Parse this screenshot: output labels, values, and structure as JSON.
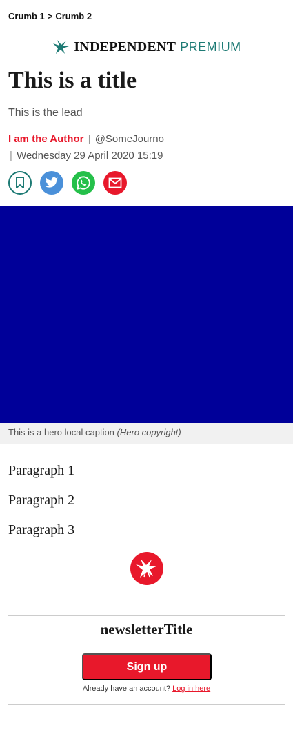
{
  "breadcrumbs": {
    "items": [
      "Crumb 1",
      "Crumb 2"
    ],
    "separator": ">"
  },
  "masthead": {
    "brand": "INDEPENDENT",
    "tier": "PREMIUM",
    "logo_icon": "eagle-icon"
  },
  "article": {
    "title": "This is a title",
    "lead": "This is the lead",
    "author": "I am the Author",
    "handle": "@SomeJourno",
    "date": "Wednesday 29 April 2020 15:19",
    "hero_color": "#000099",
    "caption": "This is a hero local caption",
    "copyright": "(Hero copyright)",
    "paragraphs": [
      "Paragraph 1",
      "Paragraph 2",
      "Paragraph 3"
    ]
  },
  "share": [
    {
      "name": "bookmark",
      "icon": "bookmark-icon"
    },
    {
      "name": "twitter",
      "icon": "twitter-icon"
    },
    {
      "name": "whatsapp",
      "icon": "whatsapp-icon"
    },
    {
      "name": "email",
      "icon": "email-icon"
    }
  ],
  "newsletter": {
    "title": "newsletterTitle",
    "signup_label": "Sign up",
    "login_prompt": "Already have an account?",
    "login_link": "Log in here"
  },
  "colors": {
    "accent_red": "#e8182b",
    "brand_teal": "#1d7a74",
    "hero": "#000099"
  }
}
